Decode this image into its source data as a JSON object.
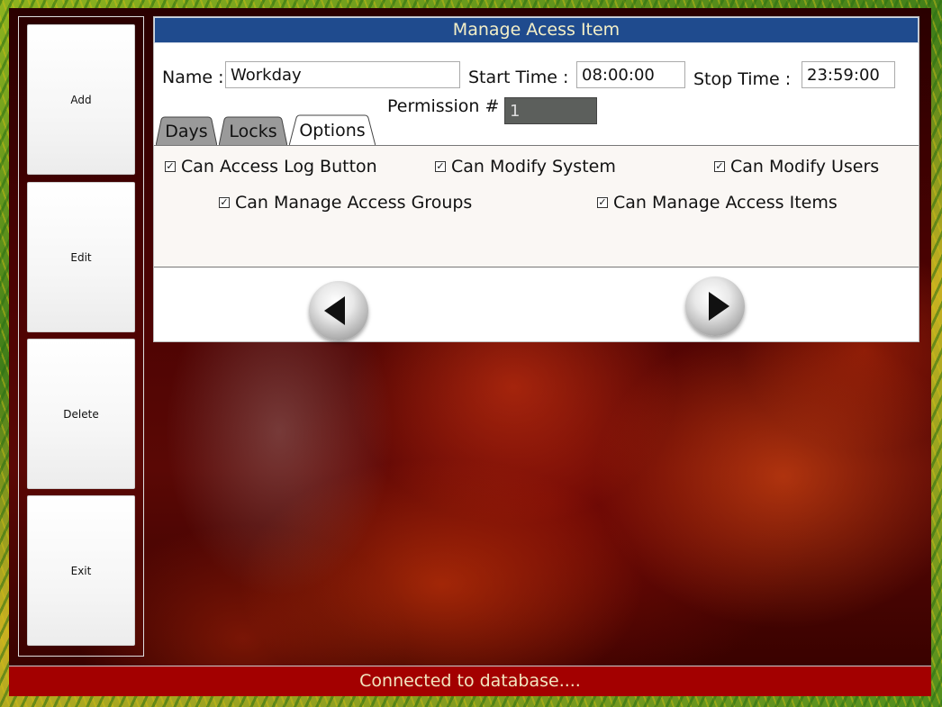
{
  "sidebar": {
    "buttons": [
      {
        "label": "Add"
      },
      {
        "label": "Edit"
      },
      {
        "label": "Delete"
      },
      {
        "label": "Exit"
      }
    ]
  },
  "panel": {
    "title": "Manage Acess Item",
    "name_label": "Name :",
    "name_value": "Workday",
    "start_label": "Start Time :",
    "start_value": "08:00:00",
    "stop_label": "Stop Time :",
    "stop_value": "23:59:00",
    "permission_label": "Permission #",
    "permission_value": "1",
    "tabs": [
      {
        "label": "Days",
        "active": false
      },
      {
        "label": "Locks",
        "active": false
      },
      {
        "label": "Options",
        "active": true
      }
    ],
    "options": [
      {
        "label": "Can Access Log Button",
        "checked": true
      },
      {
        "label": "Can Modify System",
        "checked": true
      },
      {
        "label": "Can Modify Users",
        "checked": true
      },
      {
        "label": "Can Manage Access Groups",
        "checked": true
      },
      {
        "label": "Can Manage Access Items",
        "checked": true
      }
    ],
    "nav": {
      "prev_icon": "triangle-left-icon",
      "next_icon": "triangle-right-icon"
    }
  },
  "status": {
    "text": "Connected to database...."
  },
  "colors": {
    "title_bg": "#1f4b8e",
    "status_bg": "#a30000",
    "permission_bg": "#5c5f5c"
  }
}
